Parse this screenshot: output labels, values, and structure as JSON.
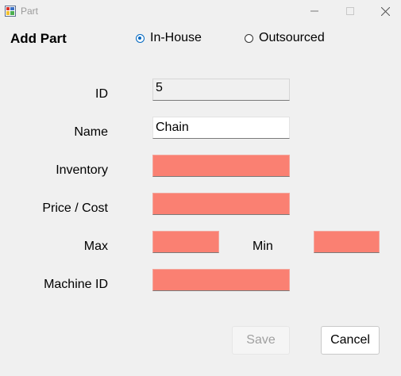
{
  "window": {
    "title": "Part",
    "app_icon": "form-app-icon",
    "controls": [
      "minimize-icon",
      "maximize-icon",
      "close-icon"
    ]
  },
  "form": {
    "heading": "Add Part",
    "source_options": [
      {
        "label": "In-House",
        "selected": true
      },
      {
        "label": "Outsourced",
        "selected": false
      }
    ],
    "fields": {
      "id": {
        "label": "ID",
        "value": "5"
      },
      "name": {
        "label": "Name",
        "value": "Chain"
      },
      "inventory": {
        "label": "Inventory",
        "value": ""
      },
      "price": {
        "label": "Price / Cost",
        "value": ""
      },
      "max": {
        "label": "Max",
        "value": ""
      },
      "min": {
        "label": "Min",
        "value": ""
      },
      "machine_id": {
        "label": "Machine ID",
        "value": ""
      }
    },
    "save_label": "Save",
    "save_enabled": false,
    "cancel_label": "Cancel"
  },
  "colors": {
    "error_field": "#fa8072",
    "accent": "#0067c0",
    "background": "#f0f0f0"
  }
}
